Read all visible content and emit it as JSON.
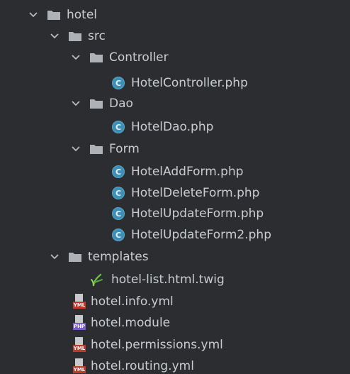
{
  "tree": {
    "root": {
      "label": "hotel",
      "children": {
        "src": {
          "label": "src",
          "controller": {
            "label": "Controller",
            "files": [
              "HotelController.php"
            ]
          },
          "dao": {
            "label": "Dao",
            "files": [
              "HotelDao.php"
            ]
          },
          "form": {
            "label": "Form",
            "files": [
              "HotelAddForm.php",
              "HotelDeleteForm.php",
              "HotelUpdateForm.php",
              "HotelUpdateForm2.php"
            ]
          }
        },
        "templates": {
          "label": "templates",
          "files": [
            "hotel-list.html.twig"
          ]
        },
        "files": [
          "hotel.info.yml",
          "hotel.module",
          "hotel.permissions.yml",
          "hotel.routing.yml"
        ]
      }
    },
    "icons": {
      "class_letter": "C",
      "yml_tag": "YML",
      "php_tag": "PHP"
    },
    "colors": {
      "background": "#2b2d30",
      "text": "#c9ccd1",
      "class_icon": "#3d8fb5",
      "yml_tag": "#c0392b",
      "php_tag": "#7b5cc4",
      "twig_leaf": "#6dbf45"
    }
  }
}
